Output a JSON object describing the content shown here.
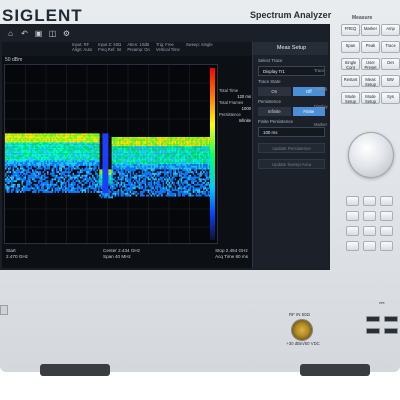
{
  "brand": "SIGLENT",
  "model_title": "Spectrum Analyzer",
  "toolbar": {
    "icons": [
      "home-icon",
      "undo-icon",
      "save-icon",
      "screenshot-icon",
      "settings-icon"
    ]
  },
  "info": [
    "Input: RF\nAlign: Auto",
    "Input Z: 50Ω\nFreq Ref: Int",
    "Atten: 10dB\nPreamp: On",
    "Trig: Free\nVertical Time",
    "Sweep: Single"
  ],
  "ref_label": "50 dBm",
  "legend": [
    {
      "label": "Total Time",
      "value": "120 ms"
    },
    {
      "label": "Total Frames",
      "value": "1000"
    },
    {
      "label": "Persistence",
      "value": "Infinite"
    }
  ],
  "footer": {
    "left": [
      "Start",
      "2.470 GHz"
    ],
    "center": [
      "Center  2.434 GHz",
      "Span  40 MHz"
    ],
    "right": [
      "Stop  2.454 GHz",
      "Acq Time  80 ms"
    ]
  },
  "menu": {
    "title": "Meas Setup",
    "select_trace_label": "Select Trace",
    "select_trace_value": "Display Tr1",
    "trace_state_label": "Trace State",
    "toggle_on": "On",
    "toggle_off": "Off",
    "persistence_label": "Persistence",
    "persistence_a": "Infinite",
    "persistence_b": "Finite",
    "finite_label": "Finite Persistence",
    "finite_value": "100 ms",
    "btn_1": "Update Persistence",
    "btn_2": "Update Sweep Area",
    "side_tabs": [
      "Trace",
      "Setting",
      "Display",
      "Marker"
    ]
  },
  "hw": {
    "section_title": "Measure",
    "keys_row1": [
      "FREQ",
      "Marker",
      "Amp"
    ],
    "keys_row2": [
      "Span",
      "Peak",
      "Trace"
    ],
    "keys_row3": [
      "Single Cont",
      "User Preset",
      "Det"
    ],
    "keys_row4": [
      "Restart",
      "Meas Setup",
      "BW"
    ],
    "keys_row5": [
      "Mode Setup",
      "Mode Setup",
      "Sys"
    ]
  },
  "rf": {
    "name": "RF IN 50Ω",
    "spec": "+30 dBm/50 VDC"
  },
  "chart_data": {
    "type": "heatmap",
    "x_label": "",
    "y_label": "",
    "start": "2.470 GHz",
    "center": "2.434 GHz",
    "span": "40 MHz",
    "stop": "2.454 GHz",
    "band_segments": [
      {
        "from": 0.0,
        "to": 0.46,
        "level": 0.62
      },
      {
        "from": 0.46,
        "to": 0.52,
        "level": 0.42
      },
      {
        "from": 0.52,
        "to": 1.0,
        "level": 0.6
      }
    ]
  },
  "colors": {
    "screen_bg": "#0c0f14",
    "accent": "#4b8fd6",
    "hot": "#ff0000",
    "cold": "#0044ff"
  }
}
